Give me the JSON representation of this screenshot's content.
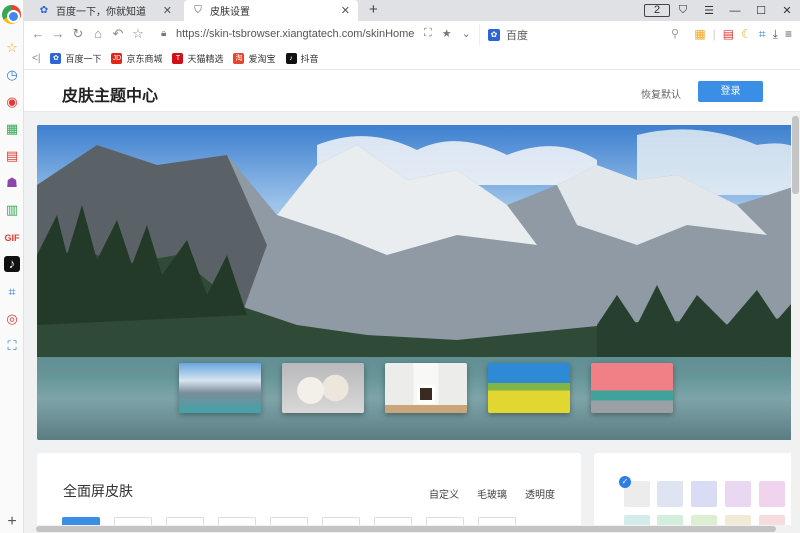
{
  "tabs": [
    {
      "label": "百度一下，你就知道",
      "icon": "baidu-paw-icon"
    },
    {
      "label": "皮肤设置",
      "icon": "shirt-icon"
    }
  ],
  "window": {
    "tab_count": "2"
  },
  "address": {
    "url": "https://skin-tsbrowser.xiangtatech.com/skinHome"
  },
  "search": {
    "engine_label": "百度"
  },
  "bookmarks": [
    {
      "label": "百度一下",
      "icon": "baidu-paw-icon",
      "color": "#2d64d6",
      "glyph": "✿"
    },
    {
      "label": "京东商城",
      "icon": "jd-icon",
      "color": "#e1251b",
      "glyph": "JD"
    },
    {
      "label": "天猫精选",
      "icon": "tmall-icon",
      "color": "#d10f1b",
      "glyph": "T"
    },
    {
      "label": "爱淘宝",
      "icon": "aitaobao-icon",
      "color": "#e8452c",
      "glyph": "淘"
    },
    {
      "label": "抖音",
      "icon": "douyin-icon",
      "color": "#111111",
      "glyph": "♪"
    }
  ],
  "header": {
    "title": "皮肤主题中心",
    "restore_label": "恢复默认",
    "login_label": "登录"
  },
  "section": {
    "title": "全面屏皮肤",
    "options": [
      "自定义",
      "毛玻璃",
      "透明度"
    ]
  },
  "colors": {
    "accent": "#3a8ee6"
  }
}
